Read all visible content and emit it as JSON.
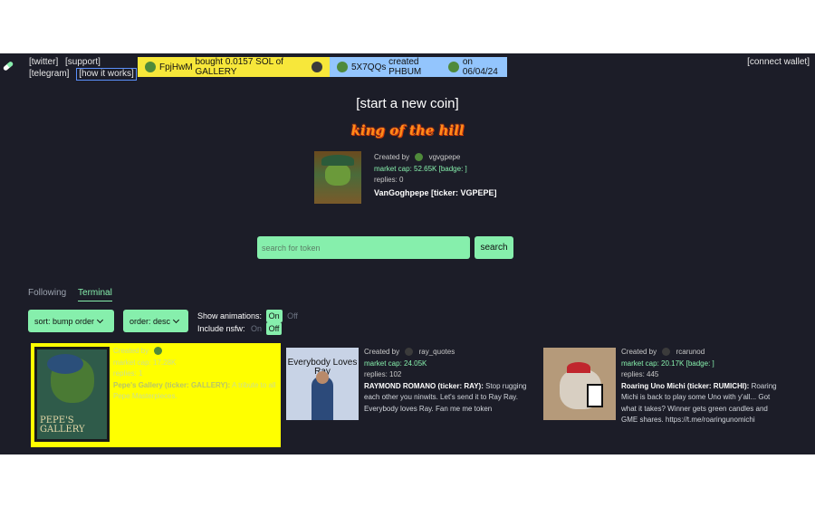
{
  "header": {
    "links": [
      "[twitter]",
      "[support]",
      "[telegram]",
      "[how it works]"
    ],
    "connect_wallet": "[connect wallet]"
  },
  "ticker": {
    "buy": {
      "user": "FpjHwM",
      "text": "bought 0.0157 SOL of GALLERY"
    },
    "create": {
      "user": "5X7QQs",
      "text": "created PHBUM",
      "date": "on 06/04/24"
    }
  },
  "start_coin": "[start a new coin]",
  "king": {
    "banner": "king of the hill",
    "created_by_label": "Created by",
    "creator": "vgvgpepe",
    "market_cap": "market cap: 52.65K",
    "badge": "[badge: ]",
    "replies": "replies: 0",
    "name": "VanGoghpepe [ticker: VGPEPE]"
  },
  "search": {
    "placeholder": "search for token",
    "button": "search"
  },
  "tabs": {
    "following": "Following",
    "terminal": "Terminal"
  },
  "controls": {
    "sort": "sort: bump order",
    "order": "order: desc",
    "show_animations_label": "Show animations:",
    "include_nsfw_label": "Include nsfw:",
    "on": "On",
    "off": "Off"
  },
  "cards": [
    {
      "created_by_label": "Created by",
      "creator": "",
      "market_cap": "market cap: 17.28K",
      "replies": "replies: 1",
      "title": "Pepe's Gallery (ticker: GALLERY):",
      "description": "A tribute to all Pepe Masterpieces.",
      "image_text": "PEPE'S GALLERY"
    },
    {
      "created_by_label": "Created by",
      "creator": "ray_quotes",
      "market_cap": "market cap: 24.05K",
      "replies": "replies: 102",
      "title": "RAYMOND ROMANO (ticker: RAY):",
      "description": "Stop rugging each other you ninwits. Let's send it to Ray Ray. Everybody loves Ray. Fan me me token",
      "image_text": "Everybody Loves Ray"
    },
    {
      "created_by_label": "Created by",
      "creator": "rcarunod",
      "market_cap": "market cap: 20.17K",
      "badge": "[badge: ]",
      "replies": "replies: 445",
      "title": "Roaring Uno Michi (ticker: RUMICHI):",
      "description": "Roaring Michi is back to play some Uno with y'all... Got what it takes? Winner gets green candles and GME shares. https://t.me/roaringunomichi"
    }
  ],
  "colors": {
    "background": "#1c1d28",
    "accent": "#86efac",
    "ticker_buy": "#f7e73a",
    "ticker_create": "#93c5fd",
    "highlight_card": "#ffff00",
    "koth": "#ff8c1a"
  }
}
